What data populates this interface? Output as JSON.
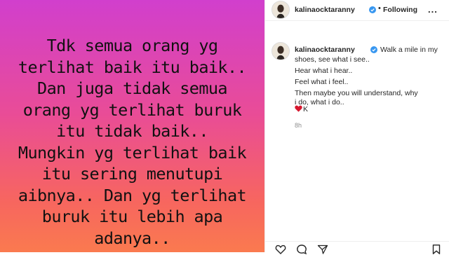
{
  "post": {
    "quote_lines": [
      "Tdk semua orang yg",
      "terlihat baik itu baik..",
      "Dan juga tidak semua",
      "orang yg terlihat buruk",
      "itu tidak baik..",
      "Mungkin yg terlihat baik",
      "itu sering menutupi",
      "aibnya.. Dan yg terlihat",
      "buruk itu lebih apa",
      "adanya.."
    ]
  },
  "header": {
    "username": "kalinaocktaranny",
    "separator": "•",
    "follow_status": "Following",
    "more_options": "..."
  },
  "caption": {
    "username": "kalinaocktaranny",
    "first_line": "Walk a mile in my",
    "line2": "shoes, see what i see..",
    "line3": "Hear what i hear..",
    "line4": "Feel what i feel..",
    "line5": "Then maybe you will understand, why",
    "line6": "i do, what i do..",
    "sign": "K",
    "time": "8h"
  },
  "icons": {
    "verified": "verified-badge-icon",
    "heart": "red-heart-emoji-icon",
    "like": "heart-outline-icon",
    "comment": "comment-icon",
    "share": "paper-plane-icon",
    "save": "bookmark-icon"
  },
  "colors": {
    "gradient_top": "#d13fcd",
    "gradient_middle": "#e94c97",
    "gradient_bottom": "#fa7a4f",
    "verified_blue": "#3897f0",
    "heart_red": "#d6172e",
    "text_dark": "#262626",
    "text_muted": "#8e8e8e"
  }
}
